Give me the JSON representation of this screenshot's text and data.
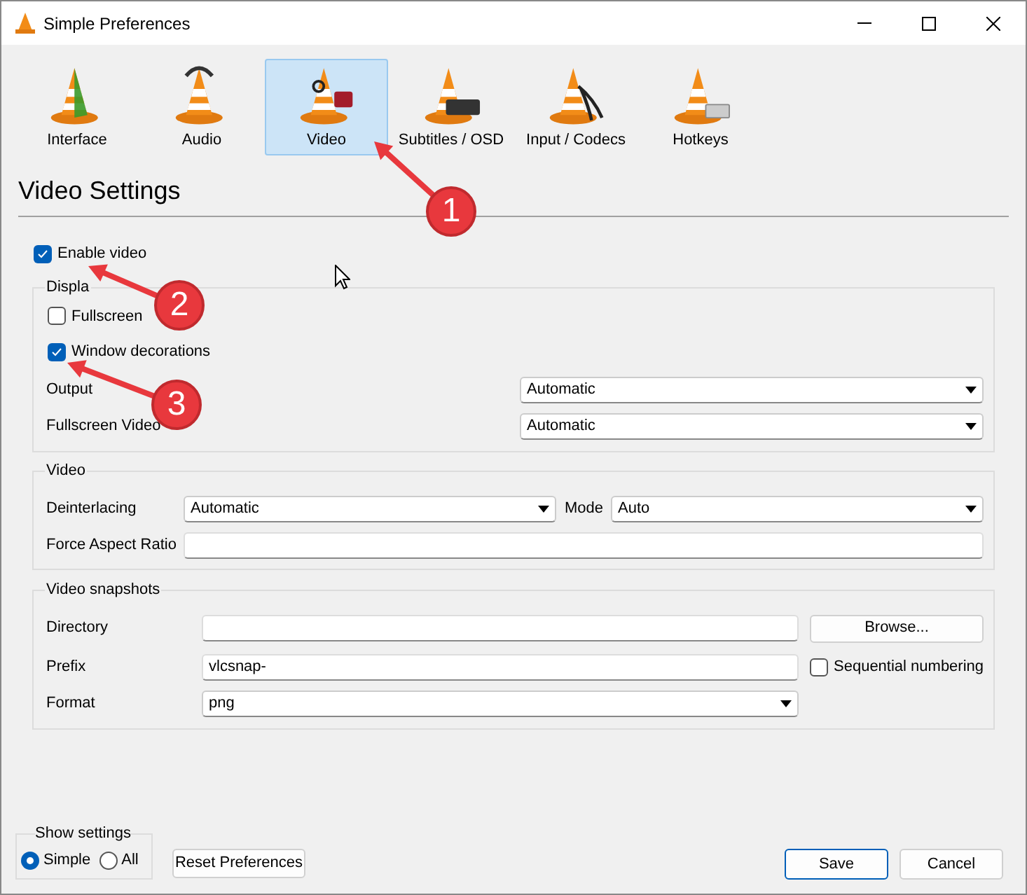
{
  "window": {
    "title": "Simple Preferences"
  },
  "tabs": [
    {
      "label": "Interface",
      "selected": false
    },
    {
      "label": "Audio",
      "selected": false
    },
    {
      "label": "Video",
      "selected": true
    },
    {
      "label": "Subtitles / OSD",
      "selected": false
    },
    {
      "label": "Input / Codecs",
      "selected": false
    },
    {
      "label": "Hotkeys",
      "selected": false
    }
  ],
  "heading": "Video Settings",
  "enable_video": {
    "label": "Enable video",
    "checked": true
  },
  "display": {
    "title": "Displa",
    "fullscreen": {
      "label": "Fullscreen",
      "checked": false
    },
    "window_decorations": {
      "label": "Window decorations",
      "checked": true
    },
    "output": {
      "label": "Output",
      "value": "Automatic"
    },
    "fullscreen_device": {
      "label": "Fullscreen Video",
      "value": "Automatic"
    }
  },
  "video": {
    "title": "Video",
    "deinterlacing": {
      "label": "Deinterlacing",
      "value": "Automatic"
    },
    "mode": {
      "label": "Mode",
      "value": "Auto"
    },
    "aspect_ratio": {
      "label": "Force Aspect Ratio"
    }
  },
  "snapshots": {
    "title": "Video snapshots",
    "directory": {
      "label": "Directory"
    },
    "browse": "Browse...",
    "prefix": {
      "label": "Prefix",
      "value": "vlcsnap-"
    },
    "sequential": {
      "label": "Sequential numbering",
      "checked": false
    },
    "format": {
      "label": "Format",
      "value": "png"
    }
  },
  "show_settings": {
    "title": "Show settings",
    "options": [
      {
        "label": "Simple",
        "selected": true
      },
      {
        "label": "All",
        "selected": false
      }
    ]
  },
  "buttons": {
    "reset": "Reset Preferences",
    "save": "Save",
    "cancel": "Cancel"
  },
  "annotations": [
    {
      "number": "1"
    },
    {
      "number": "2"
    },
    {
      "number": "3"
    }
  ]
}
